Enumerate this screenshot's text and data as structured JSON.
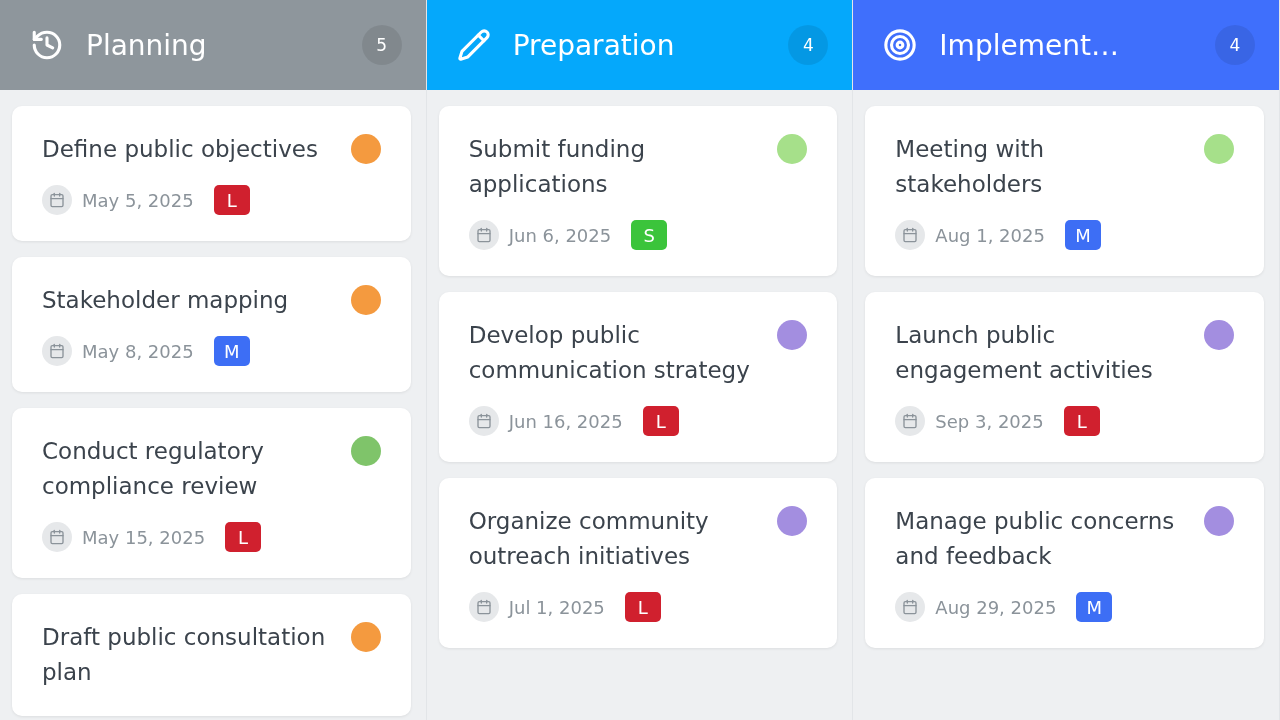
{
  "columns": [
    {
      "title": "Planning",
      "count": "5",
      "color": "#8e969c",
      "cards": [
        {
          "title": "Define public objectives",
          "date": "May 5, 2025",
          "priority": {
            "label": "L",
            "color": "#d0202e"
          },
          "avatar": {
            "color": "#f49a3f"
          }
        },
        {
          "title": "Stakeholder mapping",
          "date": "May 8, 2025",
          "priority": {
            "label": "M",
            "color": "#3d6ef5"
          },
          "avatar": {
            "color": "#f49a3f"
          }
        },
        {
          "title": "Conduct regulatory compliance review",
          "date": "May 15, 2025",
          "priority": {
            "label": "L",
            "color": "#d0202e"
          },
          "avatar": {
            "color": "#7fc46a"
          }
        },
        {
          "title": "Draft public consultation plan",
          "avatar": {
            "color": "#f49a3f"
          }
        }
      ]
    },
    {
      "title": "Preparation",
      "count": "4",
      "color": "#05a8fb",
      "cards": [
        {
          "title": "Submit funding applications",
          "date": "Jun 6, 2025",
          "priority": {
            "label": "S",
            "color": "#3bc43b"
          },
          "avatar": {
            "color": "#a6e08a"
          }
        },
        {
          "title": "Develop public communication strategy",
          "date": "Jun 16, 2025",
          "priority": {
            "label": "L",
            "color": "#d0202e"
          },
          "avatar": {
            "color": "#a38ee0"
          }
        },
        {
          "title": "Organize community outreach initiatives",
          "date": "Jul 1, 2025",
          "priority": {
            "label": "L",
            "color": "#d0202e"
          },
          "avatar": {
            "color": "#a38ee0"
          }
        }
      ]
    },
    {
      "title": "Implement…",
      "count": "4",
      "color": "#3f6ffc",
      "cards": [
        {
          "title": "Meeting with stakeholders",
          "date": "Aug 1, 2025",
          "priority": {
            "label": "M",
            "color": "#3d6ef5"
          },
          "avatar": {
            "color": "#a6e08a"
          }
        },
        {
          "title": "Launch public engagement activities",
          "date": "Sep 3, 2025",
          "priority": {
            "label": "L",
            "color": "#d0202e"
          },
          "avatar": {
            "color": "#a38ee0"
          }
        },
        {
          "title": "Manage public concerns and feedback",
          "date": "Aug 29, 2025",
          "priority": {
            "label": "M",
            "color": "#3d6ef5"
          },
          "avatar": {
            "color": "#a38ee0"
          }
        }
      ]
    }
  ]
}
